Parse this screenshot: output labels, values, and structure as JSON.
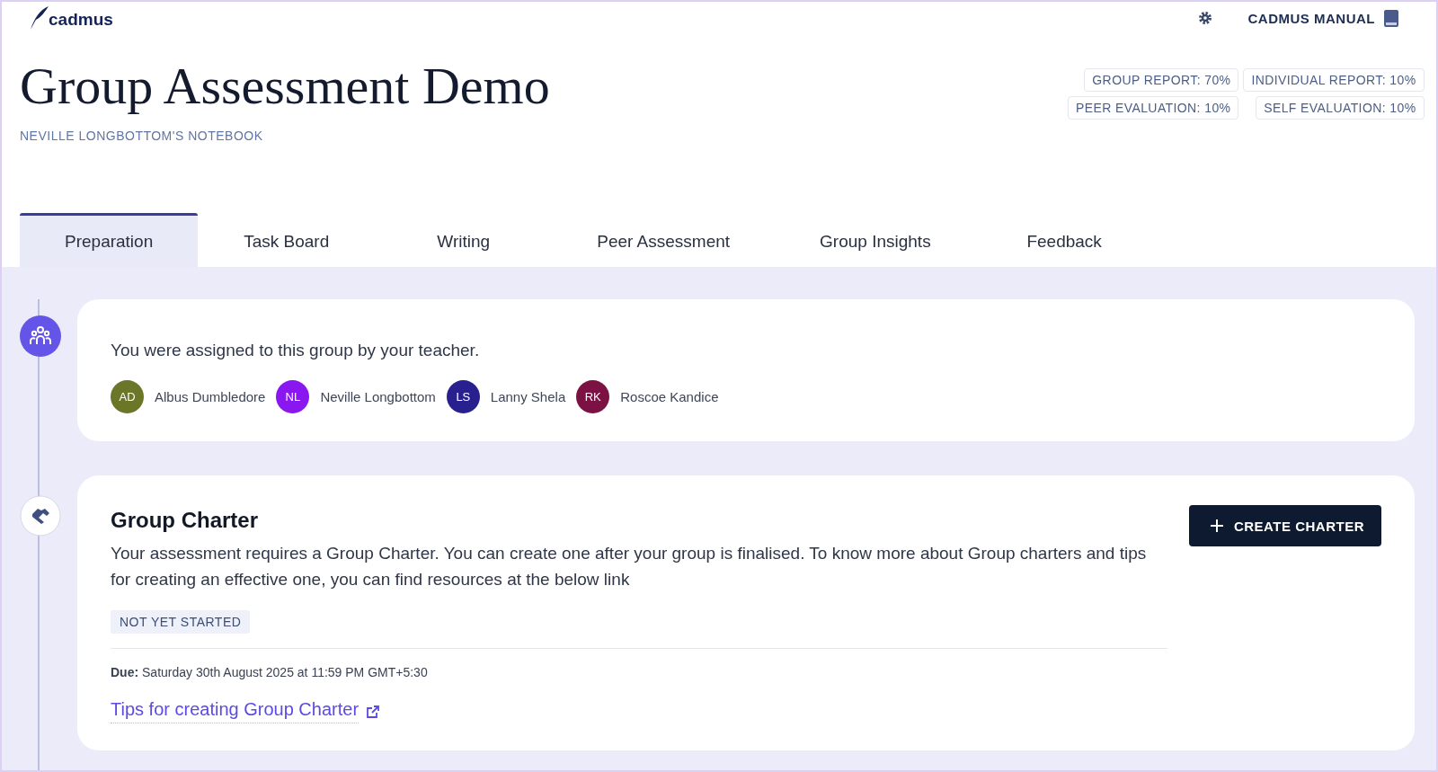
{
  "header": {
    "logo": "cadmus",
    "manual": "CADMUS MANUAL"
  },
  "title": "Group Assessment Demo",
  "subtitle": "NEVILLE LONGBOTTOM'S NOTEBOOK",
  "weights": [
    "GROUP REPORT: 70%",
    "INDIVIDUAL REPORT: 10%",
    "PEER EVALUATION: 10%",
    "SELF EVALUATION: 10%"
  ],
  "tabs": [
    {
      "label": "Preparation",
      "selected": true
    },
    {
      "label": "Task Board",
      "selected": false
    },
    {
      "label": "Writing",
      "selected": false
    },
    {
      "label": "Peer Assessment",
      "selected": false
    },
    {
      "label": "Group Insights",
      "selected": false
    },
    {
      "label": "Feedback",
      "selected": false
    }
  ],
  "group_card": {
    "text": "You were assigned to this group by your teacher.",
    "members": [
      {
        "initials": "AD",
        "name": "Albus Dumbledore",
        "color": "#6b7628"
      },
      {
        "initials": "NL",
        "name": "Neville Longbottom",
        "color": "#8a16f0"
      },
      {
        "initials": "LS",
        "name": "Lanny Shela",
        "color": "#28208f"
      },
      {
        "initials": "RK",
        "name": "Roscoe Kandice",
        "color": "#7c1243"
      }
    ]
  },
  "charter_card": {
    "title": "Group Charter",
    "description": "Your assessment requires a Group Charter. You can create one after your group is finalised. To know more about Group charters and tips for creating an effective one, you can find resources at the below link",
    "status": "NOT YET STARTED",
    "due": "**Due:** Saturday 30th August 2025 at 11:59 PM GMT+5:30",
    "link": "Tips for creating Group Charter",
    "button": "CREATE CHARTER"
  }
}
